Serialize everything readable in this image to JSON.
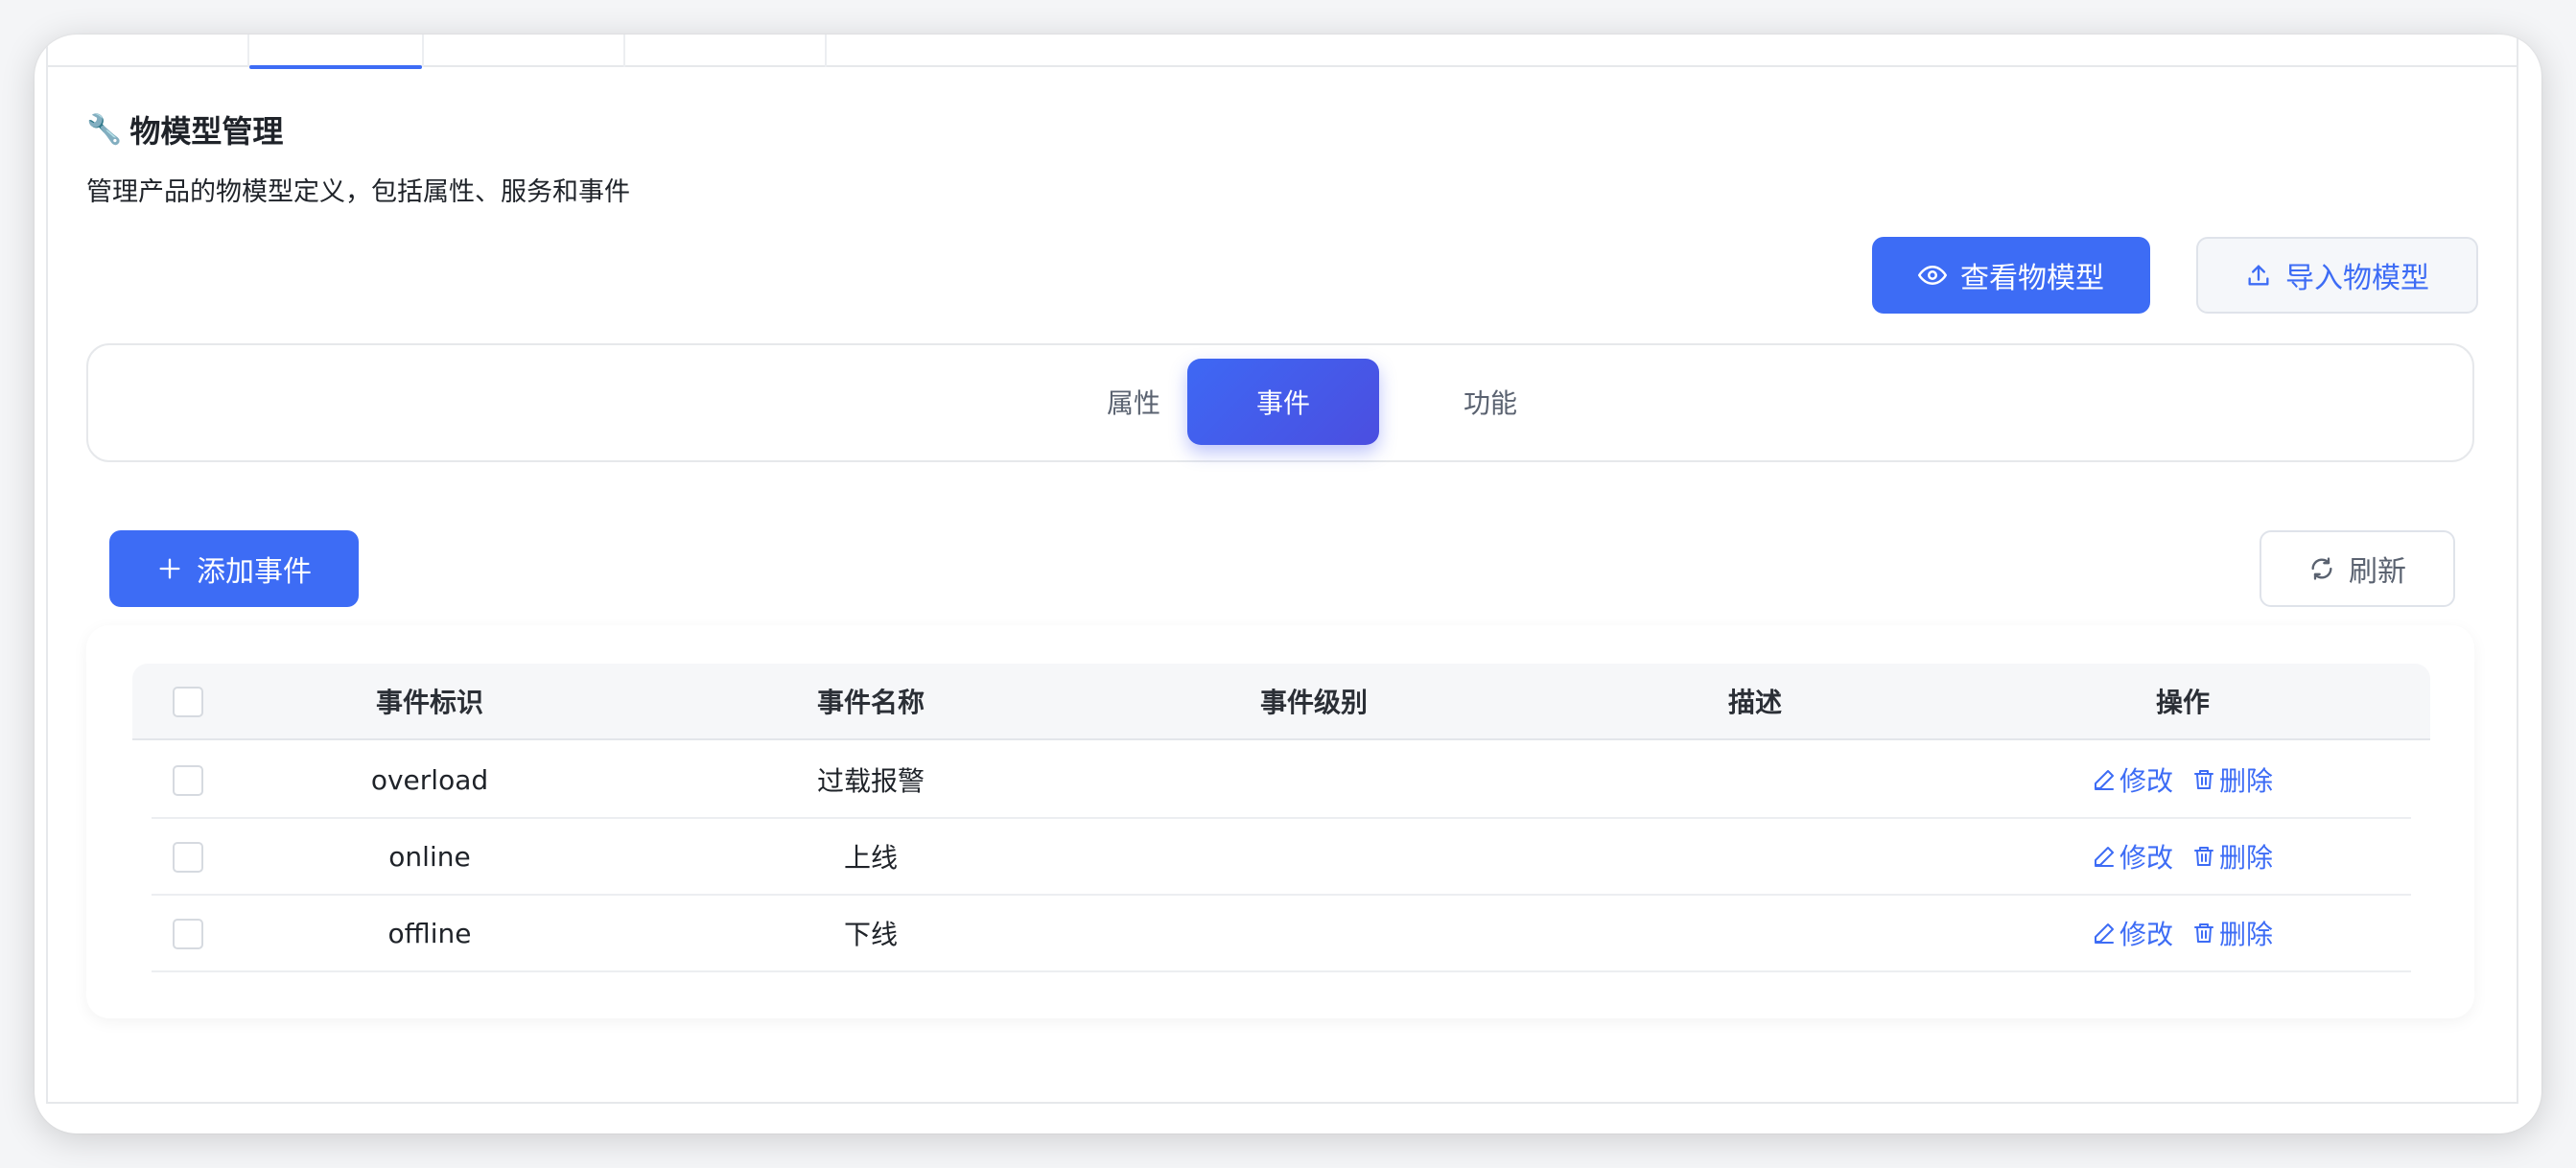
{
  "header": {
    "title": "物模型管理",
    "description": "管理产品的物模型定义，包括属性、服务和事件"
  },
  "actions": {
    "view_label": "查看物模型",
    "import_label": "导入物模型"
  },
  "segments": [
    {
      "label": "属性",
      "active": false
    },
    {
      "label": "事件",
      "active": true
    },
    {
      "label": "功能",
      "active": false
    }
  ],
  "toolbar": {
    "add_label": "添加事件",
    "refresh_label": "刷新"
  },
  "table": {
    "columns": [
      "事件标识",
      "事件名称",
      "事件级别",
      "描述",
      "操作"
    ],
    "edit_label": "修改",
    "delete_label": "删除",
    "rows": [
      {
        "id": "overload",
        "name": "过载报警",
        "level": "",
        "desc": ""
      },
      {
        "id": "online",
        "name": "上线",
        "level": "",
        "desc": ""
      },
      {
        "id": "offline",
        "name": "下线",
        "level": "",
        "desc": ""
      }
    ]
  },
  "colors": {
    "accent": "#3d6cf5",
    "border": "#e6e8eb"
  }
}
